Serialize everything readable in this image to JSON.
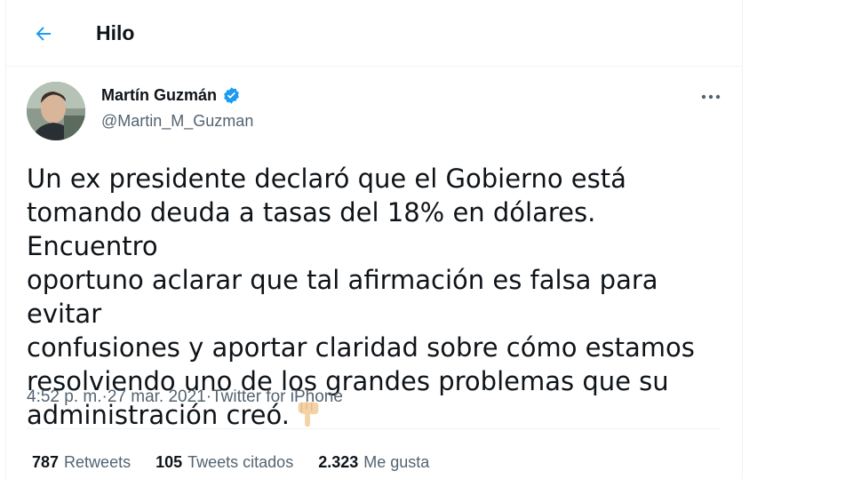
{
  "header": {
    "title": "Hilo",
    "back_icon": "arrow-left-icon"
  },
  "tweet": {
    "display_name": "Martín Guzmán",
    "handle": "@Martin_M_Guzman",
    "verified_icon": "verified-badge-icon",
    "more_icon": "more-options-icon",
    "text": "Un ex presidente declaró que el Gobierno está\ntomando deuda a tasas del 18% en dólares. Encuentro\noportuno aclarar que tal afirmación es falsa para evitar\nconfusiones y aportar claridad sobre cómo estamos\nresolviendo uno de los grandes problemas que su\nadministración creó.",
    "emoji_icon": "pointing-down-hand-icon",
    "time": "4:52 p. m.",
    "date": "27 mar. 2021",
    "source": "Twitter for iPhone",
    "separator": " · "
  },
  "stats": {
    "retweets": {
      "count": "787",
      "label": "Retweets"
    },
    "quotes": {
      "count": "105",
      "label": "Tweets citados"
    },
    "likes": {
      "count": "2.323",
      "label": "Me gusta"
    }
  },
  "colors": {
    "accent": "#1d9bf0",
    "text_primary": "#0f1419",
    "text_secondary": "#536471",
    "border": "#eff3f4"
  }
}
